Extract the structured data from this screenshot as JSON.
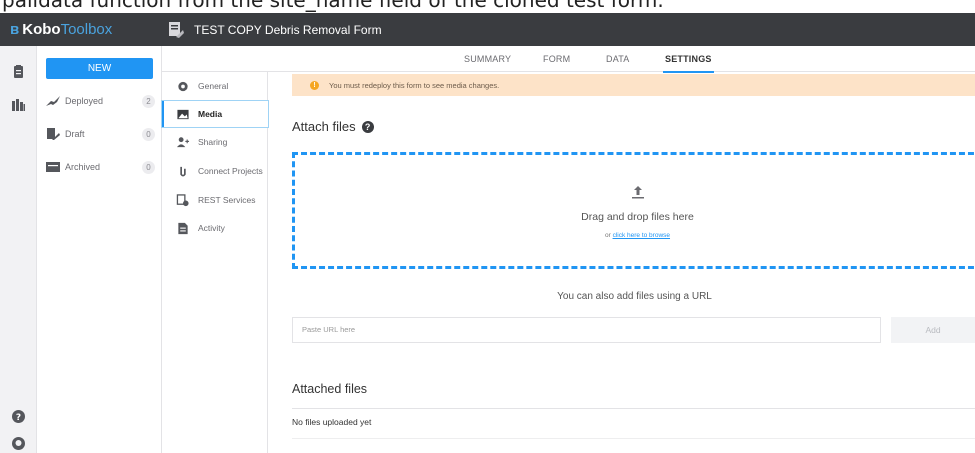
{
  "caption": {
    "text": "palidata function from the site_name field of the cloned test form."
  },
  "topbar": {
    "brand_strong": "Kobo",
    "brand_light": "Toolbox",
    "form_title": "TEST COPY Debris Removal Form"
  },
  "sidebar": {
    "new_label": "NEW",
    "items": [
      {
        "label": "Deployed",
        "count": "2",
        "icon": "rocket-icon"
      },
      {
        "label": "Draft",
        "count": "0",
        "icon": "draft-icon"
      },
      {
        "label": "Archived",
        "count": "0",
        "icon": "archive-icon"
      }
    ]
  },
  "tabs": [
    {
      "label": "SUMMARY"
    },
    {
      "label": "FORM"
    },
    {
      "label": "DATA"
    },
    {
      "label": "SETTINGS"
    }
  ],
  "subnav": [
    {
      "label": "General",
      "icon": "gear-icon"
    },
    {
      "label": "Media",
      "icon": "image-icon"
    },
    {
      "label": "Sharing",
      "icon": "user-add-icon"
    },
    {
      "label": "Connect Projects",
      "icon": "paperclip-icon"
    },
    {
      "label": "REST Services",
      "icon": "rest-services-icon"
    },
    {
      "label": "Activity",
      "icon": "activity-icon"
    }
  ],
  "main": {
    "alert": "You must redeploy this form to see media changes.",
    "attach_title": "Attach files",
    "dropzone_text": "Drag and drop files here",
    "dropzone_or": "or",
    "dropzone_link": "click here to browse",
    "url_label": "You can also add files using a URL",
    "url_placeholder": "Paste URL here",
    "add_label": "Add",
    "attached_title": "Attached files",
    "no_files": "No files uploaded yet"
  },
  "colors": {
    "accent": "#2095f3",
    "topbar": "#3a3c40",
    "alert_bg": "#fde3c8"
  }
}
